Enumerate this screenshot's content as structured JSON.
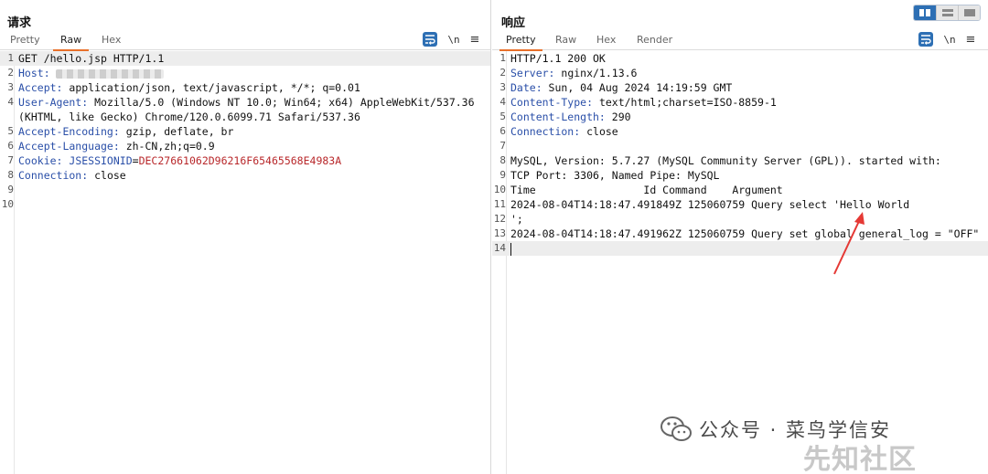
{
  "request": {
    "title": "请求",
    "tabs": [
      "Pretty",
      "Raw",
      "Hex"
    ],
    "active_tab": "Raw",
    "tools": {
      "newline": "\\n",
      "menu": "≡"
    },
    "lines": [
      {
        "n": "1",
        "parts": [
          {
            "t": "GET /hello.jsp HTTP/1.1",
            "c": ""
          }
        ]
      },
      {
        "n": "2",
        "parts": [
          {
            "t": "Host:",
            "c": "hk"
          }
        ],
        "redacted": true
      },
      {
        "n": "3",
        "parts": [
          {
            "t": "Accept:",
            "c": "hk"
          },
          {
            "t": " application/json, text/javascript, */*; q=0.01",
            "c": ""
          }
        ]
      },
      {
        "n": "4",
        "parts": [
          {
            "t": "User-Agent:",
            "c": "hk"
          },
          {
            "t": " Mozilla/5.0 (Windows NT 10.0; Win64; x64) AppleWebKit/537.36",
            "c": ""
          }
        ]
      },
      {
        "n": "",
        "parts": [
          {
            "t": "(KHTML, like Gecko) Chrome/120.0.6099.71 Safari/537.36",
            "c": ""
          }
        ]
      },
      {
        "n": "5",
        "parts": [
          {
            "t": "Accept-Encoding:",
            "c": "hk"
          },
          {
            "t": " gzip, deflate, br",
            "c": ""
          }
        ]
      },
      {
        "n": "6",
        "parts": [
          {
            "t": "Accept-Language:",
            "c": "hk"
          },
          {
            "t": " zh-CN,zh;q=0.9",
            "c": ""
          }
        ]
      },
      {
        "n": "7",
        "parts": [
          {
            "t": "Cookie:",
            "c": "hk"
          },
          {
            "t": " JSESSIONID",
            "c": "ck-name"
          },
          {
            "t": "=",
            "c": ""
          },
          {
            "t": "DEC27661062D96216F65465568E4983A",
            "c": "ck-val"
          }
        ]
      },
      {
        "n": "8",
        "parts": [
          {
            "t": "Connection:",
            "c": "hk"
          },
          {
            "t": " close",
            "c": ""
          }
        ]
      },
      {
        "n": "9",
        "parts": []
      },
      {
        "n": "10",
        "parts": []
      }
    ]
  },
  "response": {
    "title": "响应",
    "tabs": [
      "Pretty",
      "Raw",
      "Hex",
      "Render"
    ],
    "active_tab": "Pretty",
    "tools": {
      "newline": "\\n",
      "menu": "≡"
    },
    "lines": [
      {
        "n": "1",
        "parts": [
          {
            "t": "HTTP/1.1 200 OK",
            "c": ""
          }
        ]
      },
      {
        "n": "2",
        "parts": [
          {
            "t": "Server:",
            "c": "hk"
          },
          {
            "t": " nginx/1.13.6",
            "c": ""
          }
        ]
      },
      {
        "n": "3",
        "parts": [
          {
            "t": "Date:",
            "c": "hk"
          },
          {
            "t": " Sun, 04 Aug 2024 14:19:59 GMT",
            "c": ""
          }
        ]
      },
      {
        "n": "4",
        "parts": [
          {
            "t": "Content-Type:",
            "c": "hk"
          },
          {
            "t": " text/html;charset=ISO-8859-1",
            "c": ""
          }
        ]
      },
      {
        "n": "5",
        "parts": [
          {
            "t": "Content-Length:",
            "c": "hk"
          },
          {
            "t": " 290",
            "c": ""
          }
        ]
      },
      {
        "n": "6",
        "parts": [
          {
            "t": "Connection:",
            "c": "hk"
          },
          {
            "t": " close",
            "c": ""
          }
        ]
      },
      {
        "n": "7",
        "parts": []
      },
      {
        "n": "8",
        "parts": [
          {
            "t": "MySQL, Version: 5.7.27 (MySQL Community Server (GPL)). started with:",
            "c": ""
          }
        ]
      },
      {
        "n": "9",
        "parts": [
          {
            "t": "TCP Port: 3306, Named Pipe: MySQL",
            "c": ""
          }
        ]
      },
      {
        "n": "10",
        "parts": [
          {
            "t": "Time                 Id Command    Argument",
            "c": ""
          }
        ]
      },
      {
        "n": "11",
        "parts": [
          {
            "t": "2024-08-04T14:18:47.491849Z 125060759 Query select 'Hello World",
            "c": ""
          }
        ]
      },
      {
        "n": "12",
        "parts": [
          {
            "t": "';",
            "c": ""
          }
        ]
      },
      {
        "n": "13",
        "parts": [
          {
            "t": "2024-08-04T14:18:47.491962Z 125060759 Query set global general_log = \"OFF\"",
            "c": ""
          }
        ]
      },
      {
        "n": "14",
        "parts": [],
        "cursor": true
      }
    ]
  },
  "watermark": {
    "channel": "公众号 · 菜鸟学信安",
    "site": "先知社区"
  },
  "colors": {
    "accent_tab": "#e8702a",
    "header_key": "#2a4fa8",
    "cookie_value": "#b8272a",
    "toolbar_blue": "#2d6fb4",
    "arrow_red": "#e53935"
  }
}
